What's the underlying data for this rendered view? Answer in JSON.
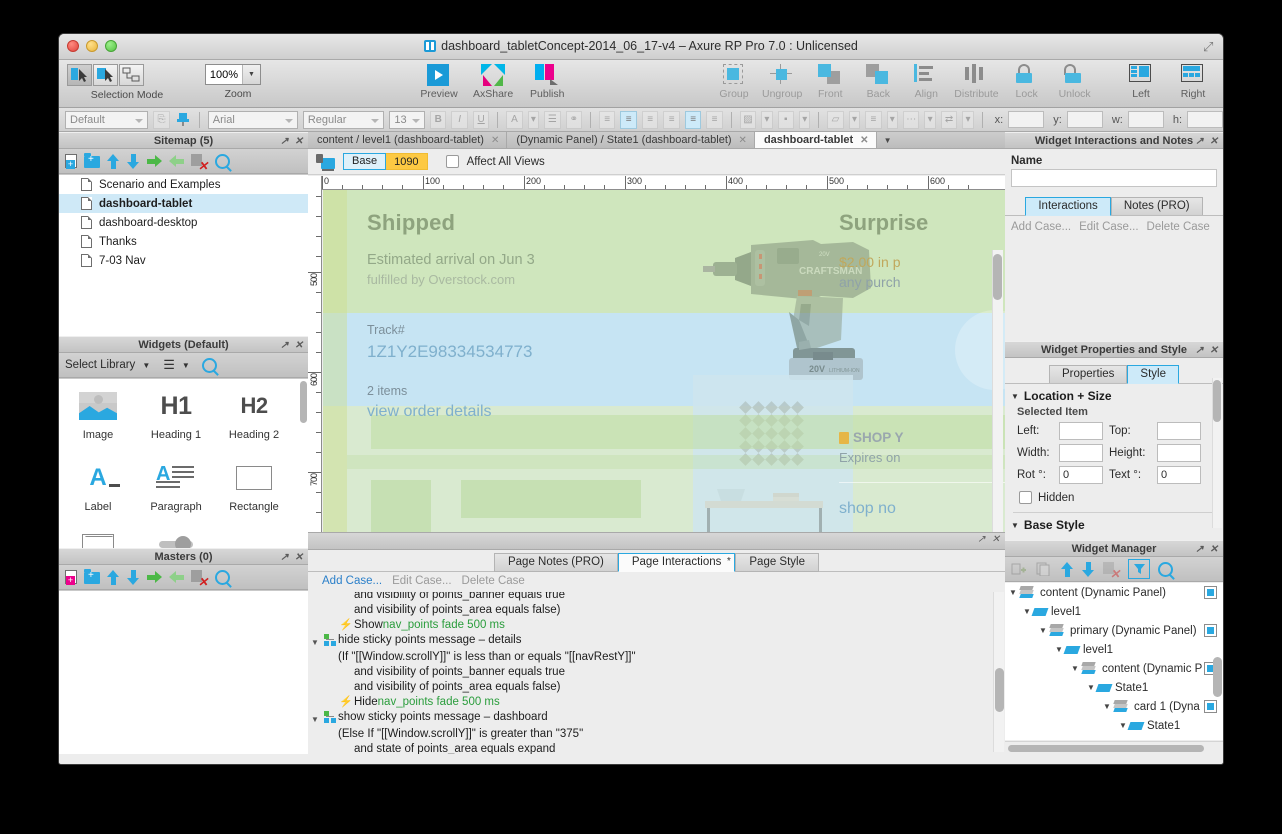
{
  "window": {
    "title": "dashboard_tabletConcept-2014_06_17-v4 – Axure RP Pro 7.0 : Unlicensed"
  },
  "toolbar": {
    "selection_mode_label": "Selection Mode",
    "zoom_label": "Zoom",
    "zoom_value": "100%",
    "buttons": [
      {
        "name": "preview",
        "label": "Preview"
      },
      {
        "name": "axshare",
        "label": "AxShare"
      },
      {
        "name": "publish",
        "label": "Publish"
      },
      {
        "name": "group",
        "label": "Group"
      },
      {
        "name": "ungroup",
        "label": "Ungroup"
      },
      {
        "name": "front",
        "label": "Front"
      },
      {
        "name": "back",
        "label": "Back"
      },
      {
        "name": "align",
        "label": "Align"
      },
      {
        "name": "distribute",
        "label": "Distribute"
      },
      {
        "name": "lock",
        "label": "Lock"
      },
      {
        "name": "unlock",
        "label": "Unlock"
      },
      {
        "name": "left-panel",
        "label": "Left"
      },
      {
        "name": "right-panel",
        "label": "Right"
      }
    ]
  },
  "formatbar": {
    "style_value": "Default",
    "font_value": "Arial",
    "weight_value": "Regular",
    "size_value": "13",
    "bold": "B",
    "italic": "I",
    "underline": "U",
    "x_label": "x:",
    "y_label": "y:",
    "w_label": "w:",
    "h_label": "h:",
    "x_value": "",
    "y_value": "",
    "w_value": "",
    "h_value": ""
  },
  "sitemap": {
    "title": "Sitemap (5)",
    "items": [
      {
        "label": "Scenario and Examples",
        "selected": false
      },
      {
        "label": "dashboard-tablet",
        "selected": true
      },
      {
        "label": "dashboard-desktop",
        "selected": false
      },
      {
        "label": "Thanks",
        "selected": false
      },
      {
        "label": "7-03 Nav",
        "selected": false
      }
    ]
  },
  "widgets": {
    "title": "Widgets (Default)",
    "select_library": "Select Library",
    "items": [
      {
        "label": "Image"
      },
      {
        "label": "Heading 1",
        "glyph": "H1"
      },
      {
        "label": "Heading 2",
        "glyph": "H2"
      },
      {
        "label": "Label"
      },
      {
        "label": "Paragraph"
      },
      {
        "label": "Rectangle"
      }
    ]
  },
  "masters": {
    "title": "Masters (0)"
  },
  "canvas": {
    "tabs": [
      {
        "label": "content / level1 (dashboard-tablet)",
        "active": false
      },
      {
        "label": "(Dynamic Panel) / State1 (dashboard-tablet)",
        "active": false
      },
      {
        "label": "dashboard-tablet",
        "active": true
      }
    ],
    "viewbar": {
      "base_label": "Base",
      "width_value": "1090",
      "affect_all_views": "Affect All Views"
    },
    "ruler_h": [
      "0",
      "100",
      "200",
      "300",
      "400",
      "500",
      "600"
    ],
    "ruler_v": [
      "500",
      "600",
      "700"
    ],
    "design": {
      "shipped_title": "Shipped",
      "shipped_eta": "Estimated arrival on Jun 3",
      "shipped_fulfilled": "fulfilled by Overstock.com",
      "track_label": "Track#",
      "track_number": "1Z1Y2E98334534773",
      "items_count": "2 items",
      "view_order": "view order details",
      "surprise_title": "Surprise",
      "surprise_line1": "$2.00 in p",
      "surprise_line2": "any purch",
      "shop_label": "SHOP Y",
      "expires_label": "Expires on",
      "shop_now": "shop no"
    }
  },
  "bottom_panel": {
    "tabs": [
      {
        "label": "Page Notes (PRO)",
        "active": false
      },
      {
        "label": "Page Interactions",
        "active": true,
        "star": "*"
      },
      {
        "label": "Page Style",
        "active": false
      }
    ],
    "actions": {
      "add": "Add Case...",
      "edit": "Edit Case...",
      "delete": "Delete Case"
    },
    "rows": [
      {
        "type": "cond",
        "indent": 2,
        "text": "and visibility of points_banner equals true"
      },
      {
        "type": "cond",
        "indent": 2,
        "text": "and visibility of points_area equals false)"
      },
      {
        "type": "action",
        "indent": 1,
        "verb": "Show ",
        "target": "nav_points fade 500 ms"
      },
      {
        "type": "case",
        "indent": 0,
        "text": "hide sticky points message – details"
      },
      {
        "type": "cond",
        "indent": 1,
        "text": "(If \"[[Window.scrollY]]\" is less than or equals \"[[navRestY]]\""
      },
      {
        "type": "cond",
        "indent": 2,
        "text": "and visibility of points_banner equals true"
      },
      {
        "type": "cond",
        "indent": 2,
        "text": "and visibility of points_area equals false)"
      },
      {
        "type": "action",
        "indent": 1,
        "verb": "Hide ",
        "target": "nav_points fade 500 ms"
      },
      {
        "type": "case",
        "indent": 0,
        "text": "show sticky points message – dashboard"
      },
      {
        "type": "cond",
        "indent": 1,
        "text": "(Else If \"[[Window.scrollY]]\" is greater than \"375\""
      },
      {
        "type": "cond",
        "indent": 2,
        "text": "and state of points_area equals expand"
      }
    ]
  },
  "widget_interactions": {
    "title": "Widget Interactions and Notes",
    "name_label": "Name",
    "name_value": "",
    "tabs": [
      {
        "label": "Interactions",
        "active": true
      },
      {
        "label": "Notes (PRO)",
        "active": false
      }
    ],
    "actions": {
      "add": "Add Case...",
      "edit": "Edit Case...",
      "delete": "Delete Case"
    }
  },
  "widget_properties": {
    "title": "Widget Properties and Style",
    "tabs": [
      {
        "label": "Properties",
        "active": false
      },
      {
        "label": "Style",
        "active": true
      }
    ],
    "location_size_title": "Location + Size",
    "selected_item": "Selected Item",
    "fields": {
      "left_label": "Left:",
      "left_value": "",
      "top_label": "Top:",
      "top_value": "",
      "width_label": "Width:",
      "width_value": "",
      "height_label": "Height:",
      "height_value": "",
      "rot_label": "Rot °:",
      "rot_value": "0",
      "text_label": "Text °:",
      "text_value": "0",
      "hidden_label": "Hidden"
    },
    "base_style_title": "Base Style"
  },
  "widget_manager": {
    "title": "Widget Manager",
    "rows": [
      {
        "label": "content (Dynamic Panel)",
        "depth": 0,
        "kind": "panel",
        "check": true
      },
      {
        "label": "level1",
        "depth": 1,
        "kind": "state",
        "check": false
      },
      {
        "label": "primary (Dynamic Panel)",
        "depth": 2,
        "kind": "panel",
        "check": true
      },
      {
        "label": "level1",
        "depth": 3,
        "kind": "state",
        "check": false
      },
      {
        "label": "content (Dynamic P",
        "depth": 4,
        "kind": "panel",
        "check": true
      },
      {
        "label": "State1",
        "depth": 5,
        "kind": "state",
        "check": false
      },
      {
        "label": "card 1 (Dyna",
        "depth": 6,
        "kind": "panel",
        "check": true
      },
      {
        "label": "State1",
        "depth": 7,
        "kind": "state",
        "check": false
      }
    ]
  }
}
